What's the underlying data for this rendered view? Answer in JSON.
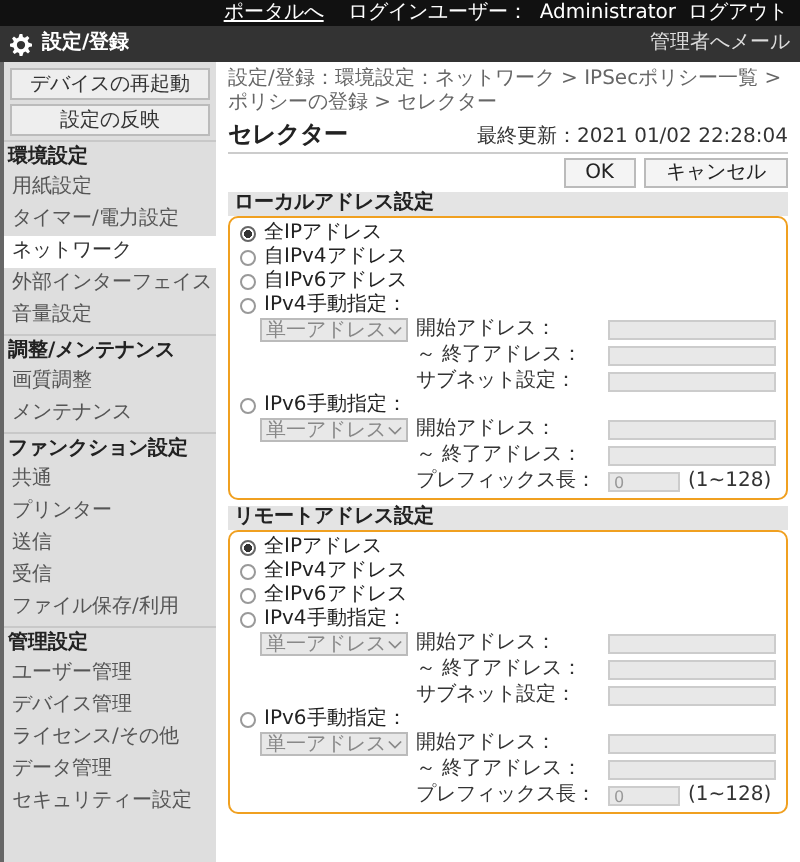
{
  "top_bar": {
    "portal_link": "ポータルへ",
    "login_label": "ログインユーザー：",
    "user": "Administrator",
    "logout_link": "ログアウト"
  },
  "title_bar": {
    "title": "設定/登録",
    "mail_link": "管理者へメール"
  },
  "sidebar": {
    "buttons": [
      "デバイスの再起動",
      "設定の反映"
    ],
    "groups": [
      {
        "title": "環境設定",
        "items": [
          {
            "label": "用紙設定",
            "selected": false
          },
          {
            "label": "タイマー/電力設定",
            "selected": false
          },
          {
            "label": "ネットワーク",
            "selected": true
          },
          {
            "label": "外部インターフェイス",
            "selected": false
          },
          {
            "label": "音量設定",
            "selected": false
          }
        ]
      },
      {
        "title": "調整/メンテナンス",
        "items": [
          {
            "label": "画質調整",
            "selected": false
          },
          {
            "label": "メンテナンス",
            "selected": false
          }
        ]
      },
      {
        "title": "ファンクション設定",
        "items": [
          {
            "label": "共通",
            "selected": false
          },
          {
            "label": "プリンター",
            "selected": false
          },
          {
            "label": "送信",
            "selected": false
          },
          {
            "label": "受信",
            "selected": false
          },
          {
            "label": "ファイル保存/利用",
            "selected": false
          }
        ]
      },
      {
        "title": "管理設定",
        "items": [
          {
            "label": "ユーザー管理",
            "selected": false
          },
          {
            "label": "デバイス管理",
            "selected": false
          },
          {
            "label": "ライセンス/その他",
            "selected": false
          },
          {
            "label": "データ管理",
            "selected": false
          },
          {
            "label": "セキュリティー設定",
            "selected": false
          }
        ]
      }
    ]
  },
  "breadcrumb": "設定/登録：環境設定：ネットワーク > IPSecポリシー一覧 > ポリシーの登録 > セレクター",
  "page_title": "セレクター",
  "last_updated": "最終更新：2021 01/02 22:28:04",
  "buttons": [
    "OK",
    "キャンセル"
  ],
  "sections": [
    {
      "title": "ローカルアドレス設定",
      "options": [
        {
          "label": "全IPアドレス",
          "selected": true
        },
        {
          "label": "自IPv4アドレス",
          "selected": false
        },
        {
          "label": "自IPv6アドレス",
          "selected": false
        },
        {
          "label": "IPv4手動指定：",
          "selected": false,
          "select": "単一アドレス",
          "disabled": true,
          "fields": [
            {
              "label": "開始アドレス："
            },
            {
              "label": "～ 終了アドレス："
            },
            {
              "label": "サブネット設定："
            }
          ]
        },
        {
          "label": "IPv6手動指定：",
          "selected": false,
          "select": "単一アドレス",
          "disabled": true,
          "fields": [
            {
              "label": "開始アドレス："
            },
            {
              "label": "～ 終了アドレス："
            },
            {
              "label": "プレフィックス長：",
              "value": "0",
              "suffix": "(1~128)"
            }
          ]
        }
      ]
    },
    {
      "title": "リモートアドレス設定",
      "options": [
        {
          "label": "全IPアドレス",
          "selected": true
        },
        {
          "label": "全IPv4アドレス",
          "selected": false
        },
        {
          "label": "全IPv6アドレス",
          "selected": false
        },
        {
          "label": "IPv4手動指定：",
          "selected": false,
          "select": "単一アドレス",
          "disabled": true,
          "fields": [
            {
              "label": "開始アドレス："
            },
            {
              "label": "～ 終了アドレス："
            },
            {
              "label": "サブネット設定："
            }
          ]
        },
        {
          "label": "IPv6手動指定：",
          "selected": false,
          "select": "単一アドレス",
          "disabled": true,
          "fields": [
            {
              "label": "開始アドレス："
            },
            {
              "label": "～ 終了アドレス："
            },
            {
              "label": "プレフィックス長：",
              "value": "0",
              "suffix": "(1~128)"
            }
          ]
        }
      ]
    }
  ]
}
